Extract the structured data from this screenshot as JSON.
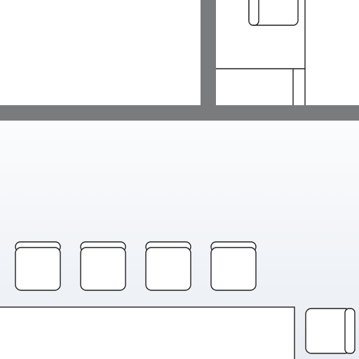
{
  "plan": {
    "rooms": [
      "upper-left-room",
      "upper-right-room",
      "lower-hall"
    ],
    "furniture": {
      "chairs_top_room": 1,
      "chairs_row": 4,
      "chairs_right": 1,
      "tables": 1,
      "cabinets": 1
    },
    "colors": {
      "wall": "#7a7b7d",
      "floor_top": "#ffffff",
      "floor_lower_start": "#fbfcfd",
      "floor_lower_end": "#e9edf3",
      "line": "#1f1f1f",
      "furniture_fill": "#ffffff"
    }
  }
}
